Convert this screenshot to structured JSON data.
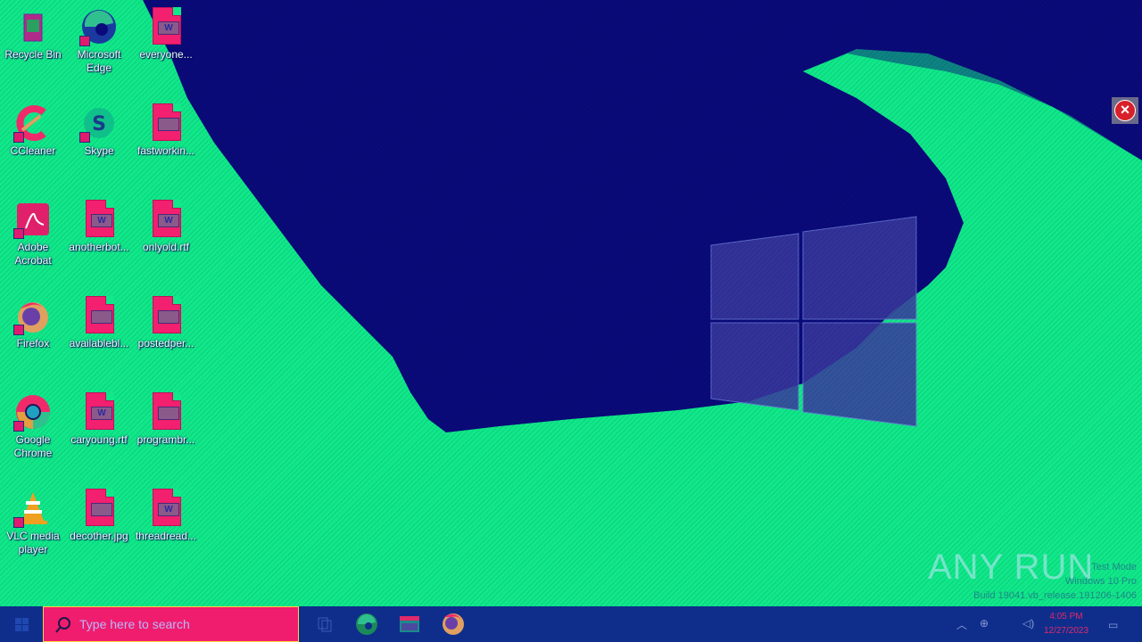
{
  "desktop": {
    "icons": [
      {
        "label": "Recycle Bin",
        "icon": "recycle-bin-icon"
      },
      {
        "label": "Microsoft Edge",
        "icon": "edge-icon"
      },
      {
        "label": "everyone...",
        "icon": "word-document-icon"
      },
      {
        "label": "CCleaner",
        "icon": "ccleaner-icon"
      },
      {
        "label": "Skype",
        "icon": "skype-icon"
      },
      {
        "label": "fastworkin...",
        "icon": "image-document-icon"
      },
      {
        "label": "Adobe Acrobat",
        "icon": "acrobat-icon"
      },
      {
        "label": "anotherbot...",
        "icon": "word-document-icon"
      },
      {
        "label": "onlyold.rtf",
        "icon": "word-document-icon"
      },
      {
        "label": "Firefox",
        "icon": "firefox-icon"
      },
      {
        "label": "availablebl...",
        "icon": "image-document-icon"
      },
      {
        "label": "postedper...",
        "icon": "image-document-icon"
      },
      {
        "label": "Google Chrome",
        "icon": "chrome-icon"
      },
      {
        "label": "caryoung.rtf",
        "icon": "word-document-icon"
      },
      {
        "label": "programbr...",
        "icon": "image-document-icon"
      },
      {
        "label": "VLC media player",
        "icon": "vlc-icon"
      },
      {
        "label": "decother.jpg",
        "icon": "image-document-icon"
      },
      {
        "label": "threadread...",
        "icon": "word-document-icon"
      }
    ]
  },
  "watermark": {
    "brand": "ANY RUN",
    "lines": [
      "Test Mode",
      "Windows 10 Pro",
      "Build 19041.vb_release.191206-1406"
    ]
  },
  "taskbar": {
    "search_placeholder": "Type here to search",
    "pinned": [
      {
        "name": "Microsoft Edge",
        "icon": "edge-icon"
      },
      {
        "name": "File Explorer",
        "icon": "file-explorer-icon"
      },
      {
        "name": "Firefox",
        "icon": "firefox-icon"
      }
    ],
    "clock": {
      "time": "4:05 PM",
      "date": "12/27/2023"
    }
  },
  "colors": {
    "wallpaper_green": "#10e88a",
    "wallpaper_navy": "#0a0a7a",
    "taskbar": "#0f2e8c",
    "search_box": "#f01c6e",
    "close": "#d8202a"
  }
}
